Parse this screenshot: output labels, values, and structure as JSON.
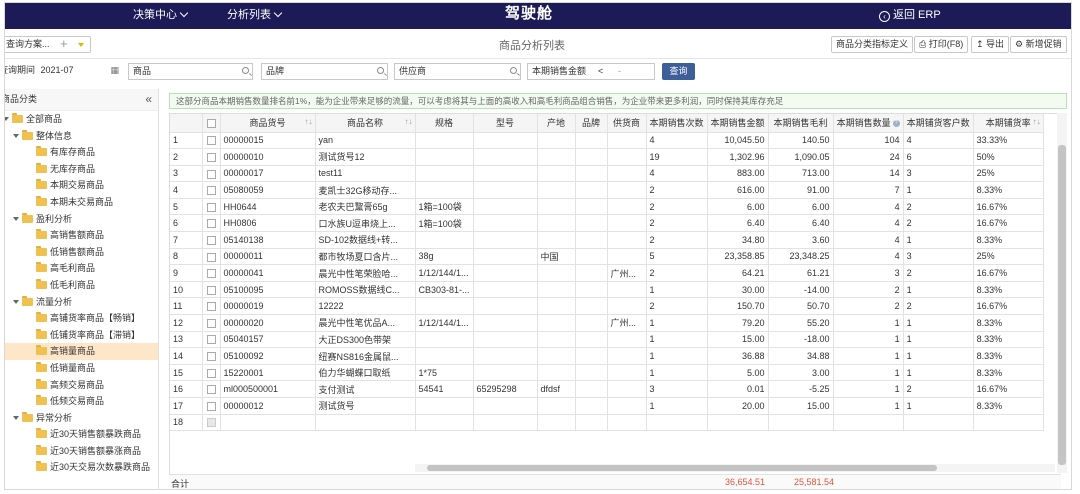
{
  "topbar": {
    "menu1": "决策中心",
    "menu2": "分析列表",
    "brand": "驾驶舱",
    "back": "返回 ERP"
  },
  "toolbar": {
    "query_plan": "查询方案",
    "page_title": "商品分析列表",
    "btn_define": "商品分类指标定义",
    "btn_print": "打印(F8)",
    "btn_export": "导出",
    "btn_promo": "新增促销"
  },
  "filters": {
    "period_label": "查询期间",
    "period_value": "2021-07",
    "goods_placeholder": "商品",
    "brand_placeholder": "品牌",
    "supplier_placeholder": "供应商",
    "metric_label": "本期销售金额",
    "operator": "<",
    "search_btn": "查询"
  },
  "sidebar": {
    "title": "商品分类",
    "items": [
      {
        "label": "全部商品",
        "level": 0,
        "arrow": true
      },
      {
        "label": "整体信息",
        "level": 1,
        "arrow": true
      },
      {
        "label": "有库存商品",
        "level": 2
      },
      {
        "label": "无库存商品",
        "level": 2
      },
      {
        "label": "本期交易商品",
        "level": 2
      },
      {
        "label": "本期未交易商品",
        "level": 2
      },
      {
        "label": "盈利分析",
        "level": 1,
        "arrow": true
      },
      {
        "label": "高销售额商品",
        "level": 2
      },
      {
        "label": "低销售额商品",
        "level": 2
      },
      {
        "label": "高毛利商品",
        "level": 2
      },
      {
        "label": "低毛利商品",
        "level": 2
      },
      {
        "label": "流量分析",
        "level": 1,
        "arrow": true
      },
      {
        "label": "高铺货率商品【畅销】",
        "level": 2
      },
      {
        "label": "低铺货率商品【滞销】",
        "level": 2
      },
      {
        "label": "高销量商品",
        "level": 2,
        "selected": true
      },
      {
        "label": "低销量商品",
        "level": 2
      },
      {
        "label": "高频交易商品",
        "level": 2
      },
      {
        "label": "低频交易商品",
        "level": 2
      },
      {
        "label": "异常分析",
        "level": 1,
        "arrow": true
      },
      {
        "label": "近30天销售额暴跌商品",
        "level": 2
      },
      {
        "label": "近30天销售额暴涨商品",
        "level": 2
      },
      {
        "label": "近30天交易次数暴跌商品",
        "level": 2
      }
    ]
  },
  "notice": "这部分商品本期销售数量排名前1%，能为企业带来足够的流量，可以考虑将其与上面的高收入和高毛利商品组合销售，为企业带来更多利润，同时保持其库存充足",
  "table": {
    "headers": [
      "商品货号",
      "商品名称",
      "规格",
      "型号",
      "产地",
      "品牌",
      "供货商",
      "本期销售次数",
      "本期销售金额",
      "本期销售毛利",
      "本期销售数量",
      "本期铺货客户数",
      "本期铺货率"
    ],
    "rows": [
      [
        "1",
        "00000015",
        "yan",
        "",
        "",
        "",
        "",
        "",
        "4",
        "10,045.50",
        "140.50",
        "104",
        "4",
        "33.33%"
      ],
      [
        "2",
        "00000010",
        "测试货号12",
        "",
        "",
        "",
        "",
        "",
        "19",
        "1,302.96",
        "1,090.05",
        "24",
        "6",
        "50%"
      ],
      [
        "3",
        "00000017",
        "test11",
        "",
        "",
        "",
        "",
        "",
        "4",
        "883.00",
        "713.00",
        "14",
        "3",
        "25%"
      ],
      [
        "4",
        "05080059",
        "麦凯士32G移动存...",
        "",
        "",
        "",
        "",
        "",
        "2",
        "616.00",
        "91.00",
        "7",
        "1",
        "8.33%"
      ],
      [
        "5",
        "HH0644",
        "老农夫巴黧膏65g",
        "1箱=100袋",
        "",
        "",
        "",
        "",
        "2",
        "6.00",
        "6.00",
        "4",
        "2",
        "16.67%"
      ],
      [
        "6",
        "HH0806",
        "口水族U逗串烧上...",
        "1箱=100袋",
        "",
        "",
        "",
        "",
        "2",
        "6.40",
        "6.40",
        "4",
        "2",
        "16.67%"
      ],
      [
        "7",
        "05140138",
        "SD-102数据线+转...",
        "",
        "",
        "",
        "",
        "",
        "2",
        "34.80",
        "3.60",
        "4",
        "1",
        "8.33%"
      ],
      [
        "8",
        "00000011",
        "都市牧场夏口含片...",
        "38g",
        "",
        "中国",
        "",
        "",
        "5",
        "23,358.85",
        "23,348.25",
        "4",
        "3",
        "25%"
      ],
      [
        "9",
        "00000041",
        "晨光中性笔荣脸哈...",
        "1/12/144/1...",
        "",
        "",
        "",
        "广州...",
        "2",
        "64.21",
        "61.21",
        "3",
        "2",
        "16.67%"
      ],
      [
        "10",
        "05100095",
        "ROMOSS数据线C...",
        "CB303-81-...",
        "",
        "",
        "",
        "",
        "1",
        "30.00",
        "-14.00",
        "2",
        "1",
        "8.33%"
      ],
      [
        "11",
        "00000019",
        "12222",
        "",
        "",
        "",
        "",
        "",
        "2",
        "150.70",
        "50.70",
        "2",
        "2",
        "16.67%"
      ],
      [
        "12",
        "00000020",
        "晨光中性笔优品A...",
        "1/12/144/1...",
        "",
        "",
        "",
        "广州...",
        "1",
        "79.20",
        "55.20",
        "1",
        "1",
        "8.33%"
      ],
      [
        "13",
        "05040157",
        "大正DS300色带架",
        "",
        "",
        "",
        "",
        "",
        "1",
        "15.00",
        "-18.00",
        "1",
        "1",
        "8.33%"
      ],
      [
        "14",
        "05100092",
        "纽赛NS816金属鼠...",
        "",
        "",
        "",
        "",
        "",
        "1",
        "36.88",
        "34.88",
        "1",
        "1",
        "8.33%"
      ],
      [
        "15",
        "15220001",
        "伯力华蝴蝶口取纸",
        "1*75",
        "",
        "",
        "",
        "",
        "1",
        "5.00",
        "3.00",
        "1",
        "1",
        "8.33%"
      ],
      [
        "16",
        "ml000500001",
        "支付测试",
        "54541",
        "65295298",
        "dfdsf",
        "",
        "",
        "3",
        "0.01",
        "-5.25",
        "1",
        "2",
        "16.67%"
      ],
      [
        "17",
        "00000012",
        "测试货号",
        "",
        "",
        "",
        "",
        "",
        "1",
        "20.00",
        "15.00",
        "1",
        "1",
        "8.33%"
      ],
      [
        "18",
        "",
        "",
        "",
        "",
        "",
        "",
        "",
        "",
        "",
        "",
        "",
        "",
        ""
      ]
    ]
  },
  "totals": {
    "label": "合计",
    "amount": "36,654.51",
    "profit": "25,581.54"
  }
}
